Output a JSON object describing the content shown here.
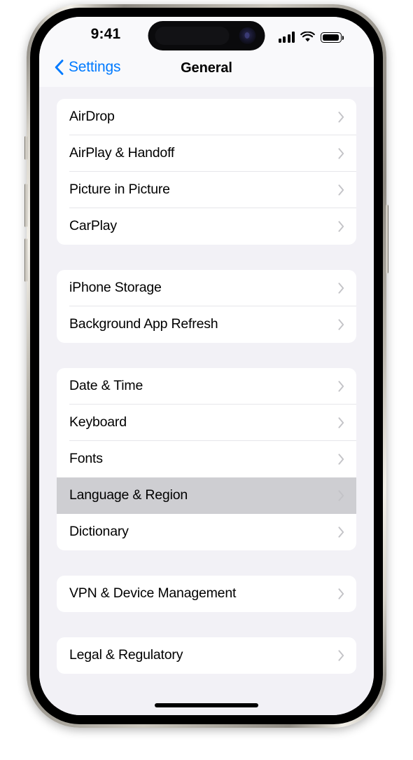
{
  "status_bar": {
    "time": "9:41",
    "cellular_icon": "cellular-bars-icon",
    "cellular_bars": 4,
    "wifi_icon": "wifi-icon",
    "battery_icon": "battery-icon",
    "battery_level_percent": 100
  },
  "nav_bar": {
    "back_label": "Settings",
    "back_icon": "chevron-left-icon",
    "title": "General"
  },
  "colors": {
    "accent_blue": "#007AFF",
    "page_background": "#F2F1F6",
    "card_background": "#FFFFFF",
    "selected_row": "#CECED2",
    "separator": "#E6E6EA",
    "chevron": "#C3C3C7"
  },
  "list": {
    "groups": [
      {
        "rows": [
          {
            "label": "AirDrop",
            "chevron": "chevron-right-icon",
            "selected": false
          },
          {
            "label": "AirPlay & Handoff",
            "chevron": "chevron-right-icon",
            "selected": false
          },
          {
            "label": "Picture in Picture",
            "chevron": "chevron-right-icon",
            "selected": false
          },
          {
            "label": "CarPlay",
            "chevron": "chevron-right-icon",
            "selected": false
          }
        ]
      },
      {
        "rows": [
          {
            "label": "iPhone Storage",
            "chevron": "chevron-right-icon",
            "selected": false
          },
          {
            "label": "Background App Refresh",
            "chevron": "chevron-right-icon",
            "selected": false
          }
        ]
      },
      {
        "rows": [
          {
            "label": "Date & Time",
            "chevron": "chevron-right-icon",
            "selected": false
          },
          {
            "label": "Keyboard",
            "chevron": "chevron-right-icon",
            "selected": false
          },
          {
            "label": "Fonts",
            "chevron": "chevron-right-icon",
            "selected": false
          },
          {
            "label": "Language & Region",
            "chevron": "chevron-right-icon",
            "selected": true
          },
          {
            "label": "Dictionary",
            "chevron": "chevron-right-icon",
            "selected": false
          }
        ]
      },
      {
        "rows": [
          {
            "label": "VPN & Device Management",
            "chevron": "chevron-right-icon",
            "selected": false
          }
        ]
      },
      {
        "rows": [
          {
            "label": "Legal & Regulatory",
            "chevron": "chevron-right-icon",
            "selected": false
          }
        ]
      }
    ]
  },
  "device": {
    "home_indicator": "home-indicator",
    "buttons": [
      "action-button",
      "volume-up-button",
      "volume-down-button",
      "power-button"
    ]
  }
}
